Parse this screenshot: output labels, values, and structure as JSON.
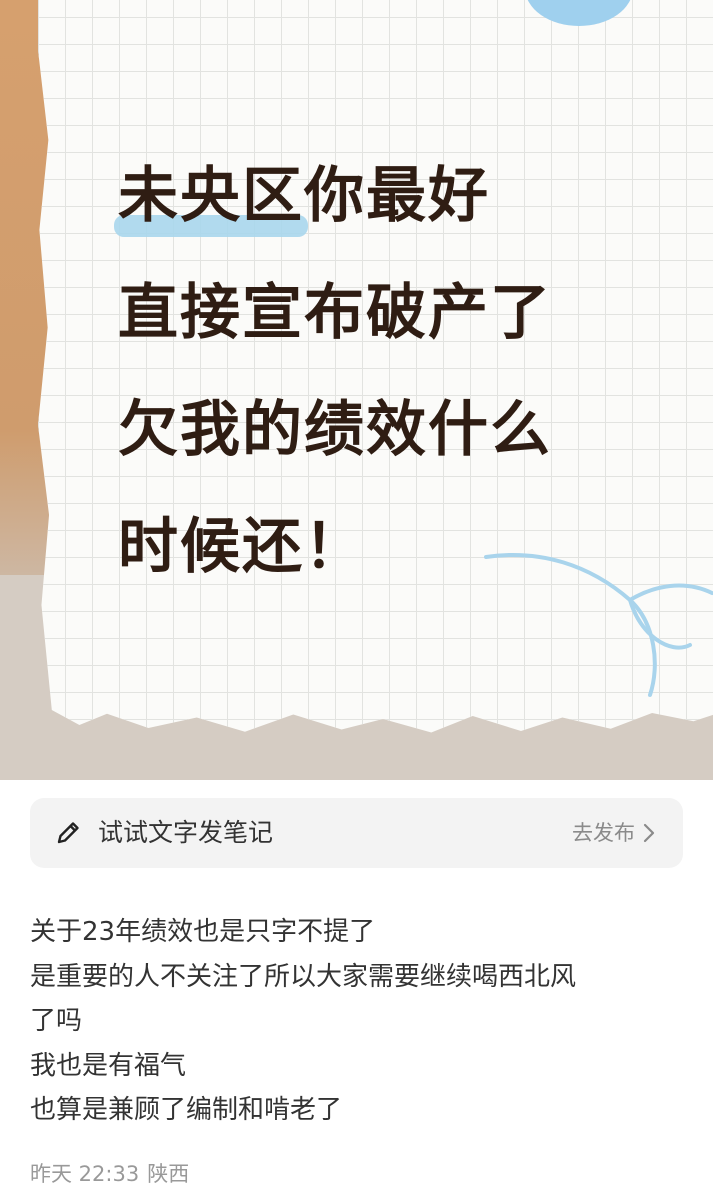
{
  "cover": {
    "headline_highlight": "未央区",
    "headline_lines": [
      "你最好",
      "直接宣布破产了",
      "欠我的绩效什么",
      "时候还！"
    ]
  },
  "publish_bar": {
    "icon": "pencil-icon",
    "prompt": "试试文字发笔记",
    "action": "去发布",
    "action_icon": "chevron-right-icon"
  },
  "post": {
    "lines": [
      "关于23年绩效也是只字不提了",
      "是重要的人不关注了所以大家需要继续喝西北风",
      "了吗",
      "我也是有福气",
      "也算是兼顾了编制和啃老了"
    ],
    "time": "昨天 22:33",
    "location": "陕西"
  },
  "colors": {
    "headline": "#2f1d13",
    "highlight": "#a8d6ec",
    "cover_tan": "#d6a06e",
    "text": "#333333",
    "muted": "#999999"
  }
}
